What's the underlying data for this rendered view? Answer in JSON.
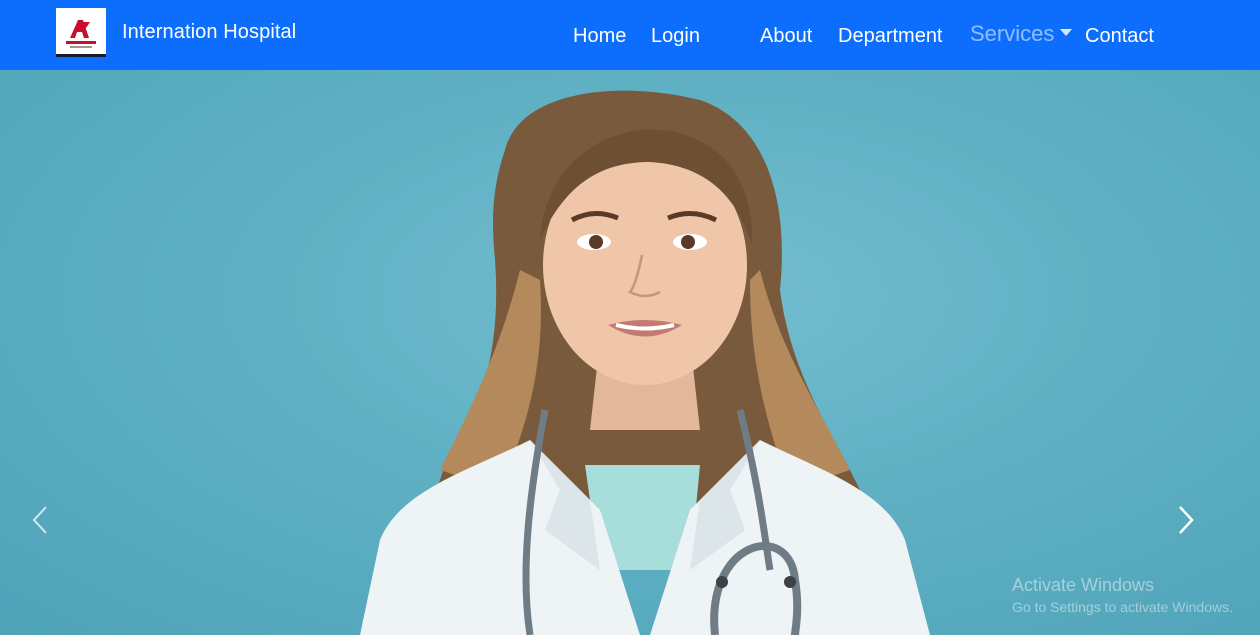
{
  "navbar": {
    "brand_name": "Internation Hospital",
    "logo_icon": "hospital-logo",
    "items": [
      {
        "label": "Home"
      },
      {
        "label": "Login"
      },
      {
        "label": "About"
      },
      {
        "label": "Department"
      },
      {
        "label": "Services"
      },
      {
        "label": "Contact"
      }
    ],
    "color": "#0d6efd"
  },
  "carousel": {
    "prev_icon": "chevron-left-icon",
    "next_icon": "chevron-right-icon",
    "slide_image": "doctor-portrait"
  },
  "watermark": {
    "title": "Activate Windows",
    "subtitle": "Go to Settings to activate Windows."
  }
}
